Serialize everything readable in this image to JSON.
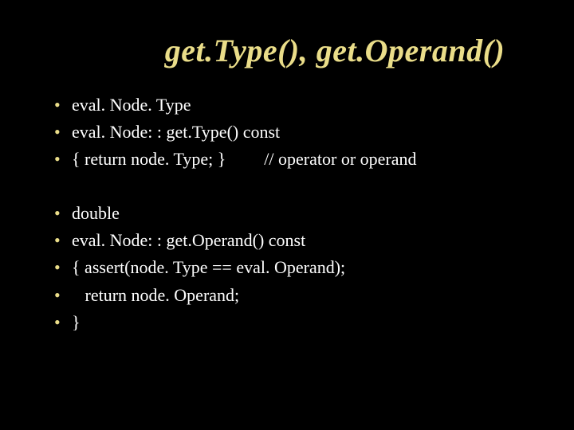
{
  "title": "get.Type(), get.Operand()",
  "group1": {
    "line1": "eval. Node. Type",
    "line2": "eval. Node: : get.Type() const",
    "line3_code": "{  return node. Type; }",
    "line3_comment": "// operator or operand"
  },
  "group2": {
    "line1": "double",
    "line2": "eval. Node: : get.Operand() const",
    "line3": "{ assert(node. Type == eval. Operand);",
    "line4": "   return node. Operand;",
    "line5": "}"
  }
}
